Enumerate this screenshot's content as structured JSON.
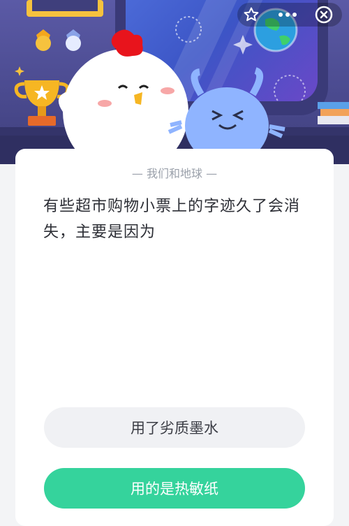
{
  "topbar": {
    "star_icon": "star-outline-icon",
    "more_icon": "more-dots-icon",
    "close_icon": "close-circle-icon"
  },
  "quiz": {
    "category": "— 我们和地球 —",
    "question": "有些超市购物小票上的字迹久了会消失，主要是因为",
    "options": [
      {
        "label": "用了劣质墨水",
        "selected": false
      },
      {
        "label": "用的是热敏纸",
        "selected": true
      }
    ]
  },
  "colors": {
    "accent_green": "#35d39c",
    "option_bg": "#f0f1f4",
    "hero_bg": "#5b5aa6"
  }
}
